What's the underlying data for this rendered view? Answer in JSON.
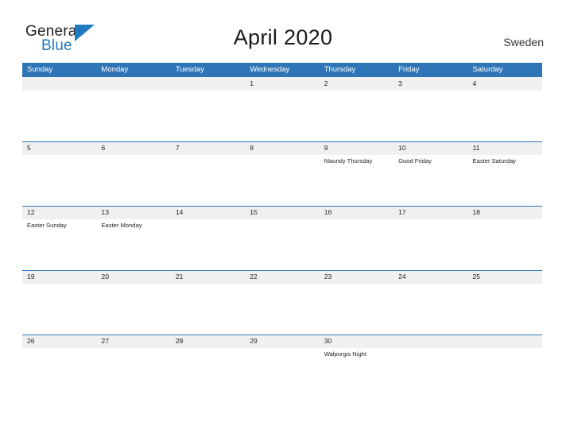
{
  "logo": {
    "word_one": "General",
    "word_two": "Blue",
    "triangle_icon": "triangle-right-icon",
    "accent_color": "#1f7ac0"
  },
  "header": {
    "title": "April 2020",
    "country": "Sweden"
  },
  "theme": {
    "header_blue": "#2f76b8",
    "band_gray": "#f0f0f0",
    "text_dark": "#231f20",
    "page_background": "#ffffff"
  },
  "calendar": {
    "month": "April",
    "year": "2020",
    "weekday_headers": [
      "Sunday",
      "Monday",
      "Tuesday",
      "Wednesday",
      "Thursday",
      "Friday",
      "Saturday"
    ],
    "weeks": [
      [
        {
          "date": "",
          "event": ""
        },
        {
          "date": "",
          "event": ""
        },
        {
          "date": "",
          "event": ""
        },
        {
          "date": "1",
          "event": ""
        },
        {
          "date": "2",
          "event": ""
        },
        {
          "date": "3",
          "event": ""
        },
        {
          "date": "4",
          "event": ""
        }
      ],
      [
        {
          "date": "5",
          "event": ""
        },
        {
          "date": "6",
          "event": ""
        },
        {
          "date": "7",
          "event": ""
        },
        {
          "date": "8",
          "event": ""
        },
        {
          "date": "9",
          "event": "Maundy Thursday"
        },
        {
          "date": "10",
          "event": "Good Friday"
        },
        {
          "date": "11",
          "event": "Easter Saturday"
        }
      ],
      [
        {
          "date": "12",
          "event": "Easter Sunday"
        },
        {
          "date": "13",
          "event": "Easter Monday"
        },
        {
          "date": "14",
          "event": ""
        },
        {
          "date": "15",
          "event": ""
        },
        {
          "date": "16",
          "event": ""
        },
        {
          "date": "17",
          "event": ""
        },
        {
          "date": "18",
          "event": ""
        }
      ],
      [
        {
          "date": "19",
          "event": ""
        },
        {
          "date": "20",
          "event": ""
        },
        {
          "date": "21",
          "event": ""
        },
        {
          "date": "22",
          "event": ""
        },
        {
          "date": "23",
          "event": ""
        },
        {
          "date": "24",
          "event": ""
        },
        {
          "date": "25",
          "event": ""
        }
      ],
      [
        {
          "date": "26",
          "event": ""
        },
        {
          "date": "27",
          "event": ""
        },
        {
          "date": "28",
          "event": ""
        },
        {
          "date": "29",
          "event": ""
        },
        {
          "date": "30",
          "event": "Walpurgis Night"
        },
        {
          "date": "",
          "event": ""
        },
        {
          "date": "",
          "event": ""
        }
      ]
    ]
  }
}
